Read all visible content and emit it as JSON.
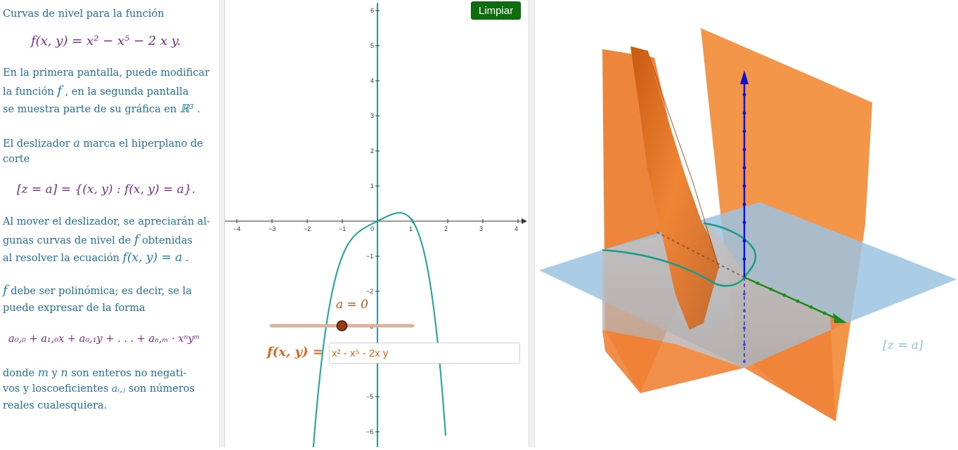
{
  "left": {
    "l1": "Curvas de nivel para la función",
    "formula": "f(x, y) = x² − x⁵ − 2 x y.",
    "p1a": "En la primera pantalla, puede modificar",
    "p1b_pre": "la función ",
    "p1b_f": "f",
    "p1b_post": " , en la segunda pantalla",
    "p1c_pre": "se muestra parte de su gráfica en ",
    "p1c_r3": "ℝ³",
    "p1c_post": " .",
    "p2a_pre": "El deslizador ",
    "p2a_a": "a",
    "p2a_post": " marca el hiperplano de",
    "p2b": "corte",
    "eq": "[z = a] = {(x, y) :  f(x, y) = a}.",
    "p3a": "Al mover el deslizador, se apreciarán al-",
    "p3b_pre": "gunas curvas de nivel de ",
    "p3b_f": "f",
    "p3b_post": " obtenidas",
    "p3c_pre": "al resolver la ecuación ",
    "p3c_eq": "f(x, y) = a",
    "p3c_post": " .",
    "p4a_f": "f",
    "p4a_post": " debe ser polinómica; es decir, se la",
    "p4b": "puede expresar de la forma",
    "poly": "a₀,₀ + a₁,₀x + a₀,₁y + . . . + aₙ,ₘ · xⁿyᵐ",
    "p5a_pre": "donde ",
    "p5a_m": "m",
    "p5a_mid": " y ",
    "p5a_n": "n",
    "p5a_post": " son enteros no negati-",
    "p5b_pre": "vos y loscoeficientes ",
    "p5b_a": "aᵢ,ⱼ",
    "p5b_post": " son números",
    "p5c": "reales cualesquiera."
  },
  "graph2d": {
    "button": "Limpiar",
    "slider_label": "a = 0",
    "slider_value": 0,
    "slider_min": -5,
    "slider_max": 5,
    "function_label": "f(x, y) =",
    "function_input": "x² - x⁵ - 2x y",
    "x_ticks": [
      "−4",
      "−3",
      "−2",
      "−1",
      "0",
      "1",
      "2",
      "3",
      "4"
    ],
    "y_ticks": [
      "6",
      "5",
      "4",
      "3",
      "2",
      "1",
      "−1",
      "−2",
      "−3",
      "−4",
      "−5",
      "−6"
    ]
  },
  "view3d": {
    "plane_label": "[z = a]"
  },
  "colors": {
    "text": "#1f6f9a",
    "math": "#7b2a8a",
    "curve": "#1aa39a",
    "button": "#0d6e0d",
    "surface": "#f07a2a",
    "plane": "#9cc3e0",
    "axis_z": "#1010d0",
    "axis_y": "#1a8a1a",
    "slider": "#d9b39c"
  }
}
